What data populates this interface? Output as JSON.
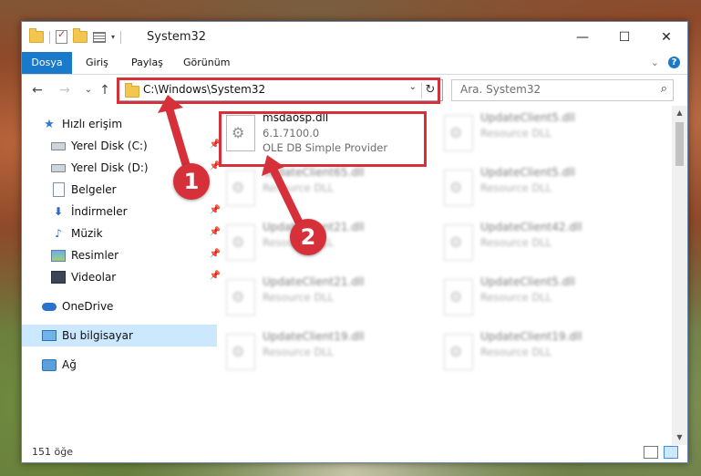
{
  "window": {
    "title": "System32",
    "controls": {
      "minimize": "—",
      "maximize": "☐",
      "close": "✕"
    }
  },
  "ribbon": {
    "tabs": [
      "Dosya",
      "Giriş",
      "Paylaş",
      "Görünüm"
    ],
    "help": "?",
    "expand": "⌄"
  },
  "nav": {
    "back": "←",
    "forward": "→",
    "recent": "⌄",
    "up": "↑",
    "address": "C:\\Windows\\System32",
    "address_dropdown": "⌄",
    "refresh": "↻",
    "search_placeholder": "Ara. System32",
    "search_icon": "⌕"
  },
  "sidebar": {
    "items": [
      {
        "label": "Hızlı erişim",
        "icon": "star-icon"
      },
      {
        "label": "Yerel Disk (C:)",
        "icon": "drive-icon",
        "pinned": true
      },
      {
        "label": "Yerel Disk (D:)",
        "icon": "drive-icon",
        "pinned": true
      },
      {
        "label": "Belgeler",
        "icon": "document-icon"
      },
      {
        "label": "İndirmeler",
        "icon": "download-icon",
        "pinned": true
      },
      {
        "label": "Müzik",
        "icon": "music-icon",
        "pinned": true
      },
      {
        "label": "Resimler",
        "icon": "picture-icon",
        "pinned": true
      },
      {
        "label": "Videolar",
        "icon": "video-icon",
        "pinned": true
      },
      {
        "label": "OneDrive",
        "icon": "cloud-icon"
      },
      {
        "label": "Bu bilgisayar",
        "icon": "computer-icon",
        "selected": true
      },
      {
        "label": "Ağ",
        "icon": "network-icon"
      }
    ],
    "pin_glyph": "📌"
  },
  "files": {
    "highlighted": {
      "name": "msdaosp.dll",
      "version": "6.1.7100.0",
      "description": "OLE DB Simple Provider"
    },
    "blurred": [
      {
        "name": "UpdateClient5.dll",
        "type": "Resource DLL"
      },
      {
        "name": "UpdateClient65.dll",
        "type": "Resource DLL"
      },
      {
        "name": "UpdateClient5.dll",
        "type": "Resource DLL"
      },
      {
        "name": "UpdateClient21.dll",
        "type": "Resource DLL"
      },
      {
        "name": "UpdateClient42.dll",
        "type": "Resource DLL"
      },
      {
        "name": "UpdateClient21.dll",
        "type": "Resource DLL"
      },
      {
        "name": "UpdateClient5.dll",
        "type": "Resource DLL"
      },
      {
        "name": "UpdateClient19.dll",
        "type": "Resource DLL"
      },
      {
        "name": "UpdateClient19.dll",
        "type": "Resource DLL"
      }
    ]
  },
  "status": {
    "count": "151 öğe"
  },
  "annotations": {
    "step1": "1",
    "step2": "2",
    "color": "#d6313a"
  }
}
